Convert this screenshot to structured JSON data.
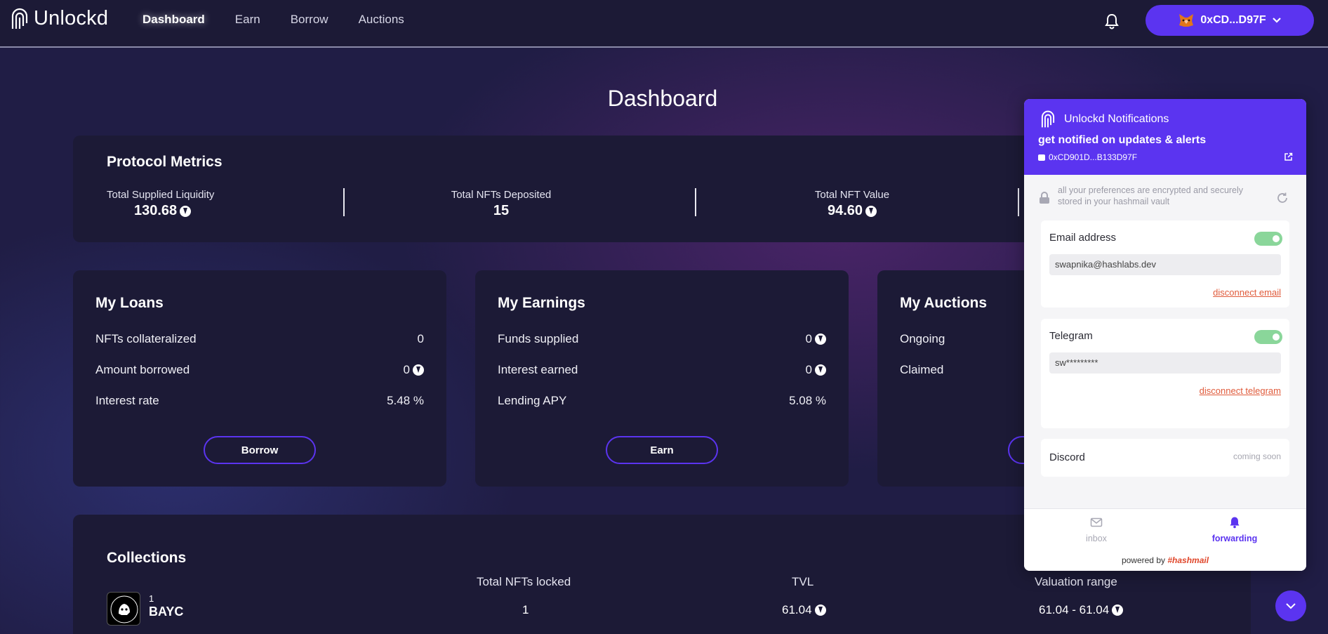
{
  "app": {
    "name": "Unlockd"
  },
  "nav": {
    "items": [
      "Dashboard",
      "Earn",
      "Borrow",
      "Auctions"
    ],
    "active": "Dashboard"
  },
  "wallet": {
    "address": "0xCD...D97F"
  },
  "page": {
    "title": "Dashboard"
  },
  "metrics": {
    "title": "Protocol Metrics",
    "items": [
      {
        "label": "Total Supplied Liquidity",
        "value": "130.68"
      },
      {
        "label": "Total NFTs Deposited",
        "value": "15"
      },
      {
        "label": "Total NFT Value",
        "value": "94.60"
      }
    ]
  },
  "loans": {
    "title": "My Loans",
    "rows": [
      {
        "label": "NFTs collateralized",
        "value": "0"
      },
      {
        "label": "Amount borrowed",
        "value": "0"
      },
      {
        "label": "Interest rate",
        "value": "5.48 %"
      }
    ],
    "button": "Borrow"
  },
  "earnings": {
    "title": "My Earnings",
    "rows": [
      {
        "label": "Funds supplied",
        "value": "0"
      },
      {
        "label": "Interest earned",
        "value": "0"
      },
      {
        "label": "Lending APY",
        "value": "5.08 %"
      }
    ],
    "button": "Earn"
  },
  "auctions": {
    "title": "My Auctions",
    "rows": [
      {
        "label": "Ongoing"
      },
      {
        "label": "Claimed"
      }
    ]
  },
  "collections": {
    "title": "Collections",
    "headers": [
      "Total NFTs locked",
      "TVL",
      "Valuation range"
    ],
    "rows": [
      {
        "index": "1",
        "name": "BAYC",
        "locked": "1",
        "tvl": "61.04",
        "range": "61.04 - 61.04"
      }
    ]
  },
  "notifications": {
    "title": "Unlockd Notifications",
    "subtitle": "get notified on updates & alerts",
    "address": "0xCD901D...B133D97F",
    "preferences_note": "all your preferences are encrypted and securely stored in your hashmail vault",
    "email": {
      "label": "Email address",
      "value": "swapnika@hashlabs.dev",
      "link": "disconnect email",
      "enabled": true
    },
    "telegram": {
      "label": "Telegram",
      "value": "sw*********",
      "link": "disconnect telegram",
      "enabled": true
    },
    "discord": {
      "label": "Discord",
      "status": "coming soon"
    },
    "tabs": {
      "inbox": "inbox",
      "forwarding": "forwarding",
      "active": "forwarding"
    },
    "powered_by": "powered by",
    "brand": "#hashmail"
  },
  "colors": {
    "accent": "#5b34f0",
    "background": "#201d45",
    "card": "#1c1a36",
    "toggle_on": "#8ad69a",
    "link_red": "#e05a3a"
  }
}
